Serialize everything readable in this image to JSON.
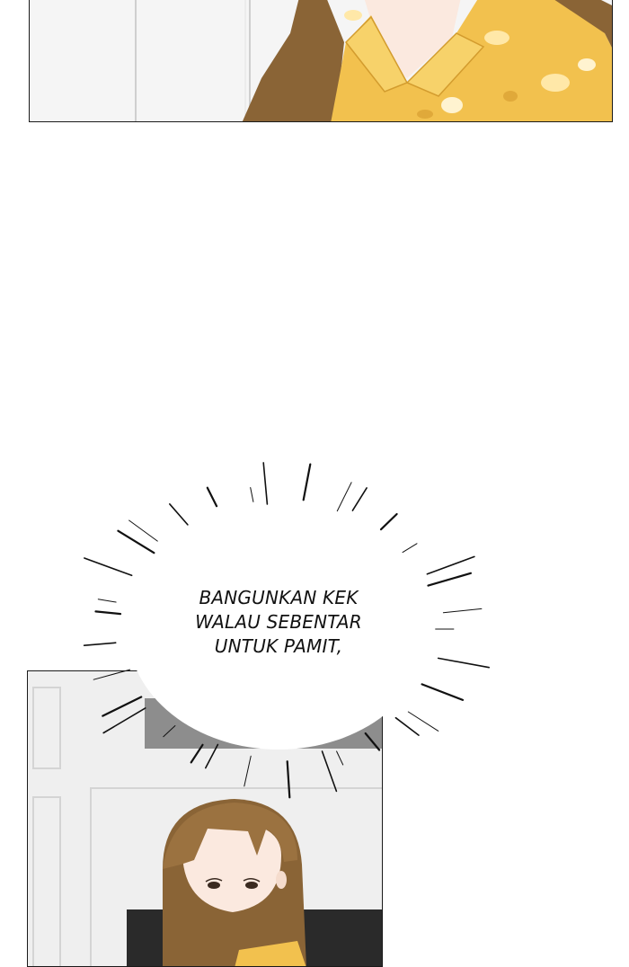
{
  "panels": [
    {
      "name": "panel-top",
      "description": "woman in yellow floral shirt"
    },
    {
      "name": "panel-bottom",
      "description": "woman with brown hair looking down"
    }
  ],
  "speech_bubble": {
    "lines": [
      "BANGUNKAN KEK",
      "WALAU SEBENTAR",
      "UNTUK PAMIT,"
    ]
  },
  "colors": {
    "shirt_yellow": "#f2c14e",
    "shirt_shadow": "#e0a93a",
    "hair_brown": "#8a6436",
    "skin": "#fbe9df",
    "background_wall": "#ececec"
  }
}
